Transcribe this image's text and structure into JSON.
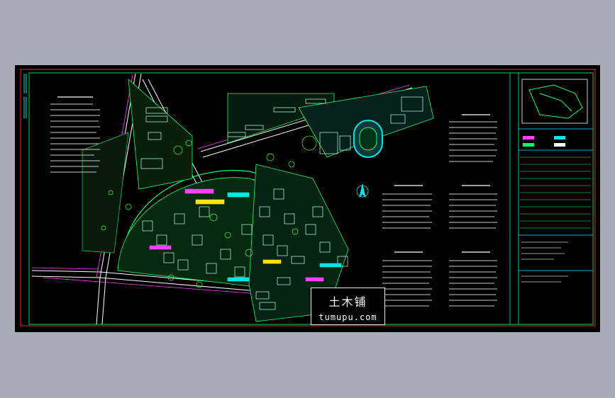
{
  "drawing": {
    "background_color": "#000000",
    "frame_color": "#ff2020",
    "border_color": "#00ff6a",
    "title_block_color": "#00e5e5"
  },
  "watermark": {
    "title": "土木铺",
    "url": "tumupu.com"
  },
  "icons": {
    "north_arrow": "north-arrow-icon",
    "location_map": "location-map-icon"
  }
}
